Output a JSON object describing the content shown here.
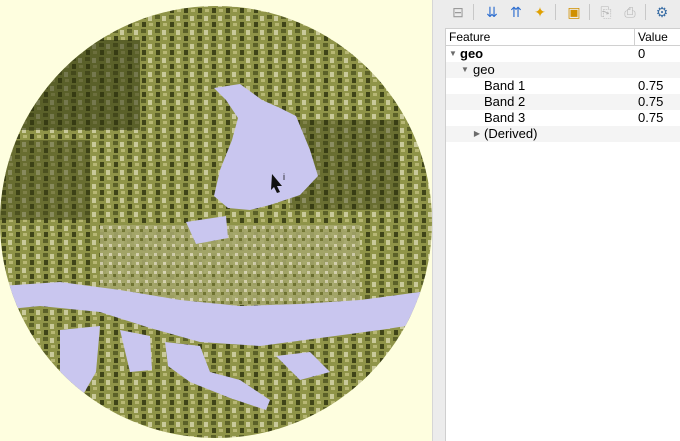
{
  "toolbar": {
    "buttons": [
      {
        "name": "expand-new-results-icon",
        "glyph": "⊟",
        "color": "#9a9a9a"
      },
      {
        "name": "expand-all-icon",
        "glyph": "⇊",
        "color": "#2f6fd0"
      },
      {
        "name": "collapse-all-icon",
        "glyph": "⇈",
        "color": "#2f6fd0"
      },
      {
        "name": "expand-tree-star-icon",
        "glyph": "✦",
        "color": "#e0a000"
      },
      {
        "name": "clear-results-icon",
        "glyph": "▣",
        "color": "#d09000"
      },
      {
        "name": "copy-feature-icon",
        "glyph": "⎘",
        "color": "#b5b5b5"
      },
      {
        "name": "print-icon",
        "glyph": "⎙",
        "color": "#b5b5b5"
      },
      {
        "name": "identify-settings-icon",
        "glyph": "⚙",
        "color": "#3a6ea5"
      }
    ]
  },
  "tree": {
    "header": {
      "feature": "Feature",
      "value": "Value"
    },
    "rows": [
      {
        "feature": "geo",
        "value": "0",
        "level": 0,
        "expanded": true,
        "bold": true
      },
      {
        "feature": "geo",
        "value": "",
        "level": 1,
        "expanded": true,
        "bold": false
      },
      {
        "feature": "Band 1",
        "value": "0.75",
        "level": 2,
        "bold": false
      },
      {
        "feature": "Band 2",
        "value": "0.75",
        "level": 2,
        "bold": false
      },
      {
        "feature": "Band 3",
        "value": "0.75",
        "level": 2,
        "bold": false
      },
      {
        "feature": "(Derived)",
        "value": "",
        "level": 2,
        "expanded": false,
        "bold": false
      }
    ]
  },
  "colors": {
    "map_background": "#fefedf",
    "land": "#8f9448",
    "water": "#c9c6ef",
    "panel_background": "#ececec"
  }
}
